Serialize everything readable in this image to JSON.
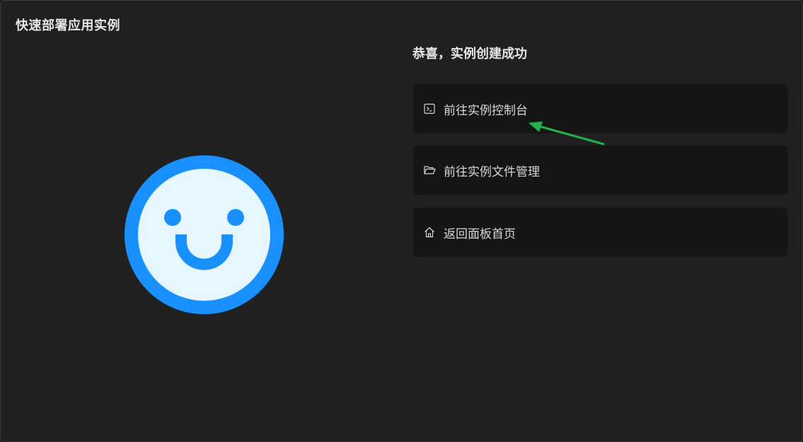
{
  "dialog": {
    "title": "快速部署应用实例"
  },
  "result": {
    "title": "恭喜，实例创建成功"
  },
  "actions": [
    {
      "label": "前往实例控制台",
      "icon": "terminal-icon"
    },
    {
      "label": "前往实例文件管理",
      "icon": "folder-open-icon"
    },
    {
      "label": "返回面板首页",
      "icon": "home-icon"
    }
  ],
  "colors": {
    "smiley_ring": "#1890ff",
    "smiley_face": "#e6f7ff",
    "annotation_arrow": "#22b14c",
    "card_bg": "#151515",
    "panel_bg": "#202020"
  }
}
